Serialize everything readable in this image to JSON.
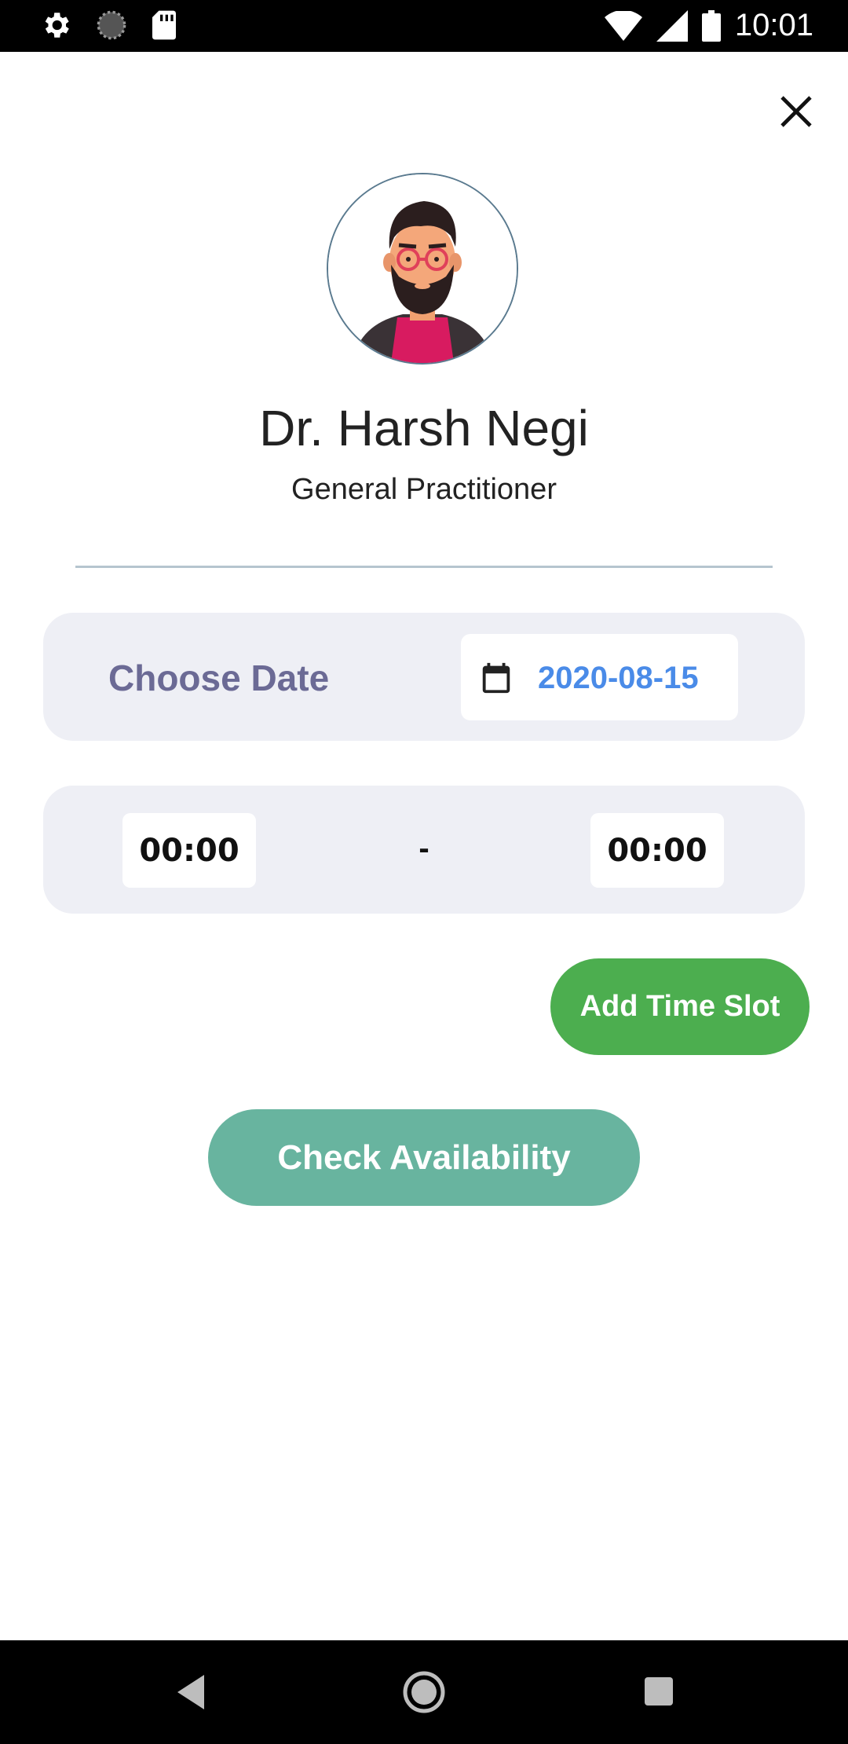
{
  "status_bar": {
    "time": "10:01",
    "left_icons": [
      "settings-icon",
      "loading-icon",
      "sd-card-icon"
    ],
    "right_icons": [
      "wifi-icon",
      "signal-icon",
      "battery-icon"
    ]
  },
  "doctor": {
    "name": "Dr. Harsh Negi",
    "specialty": "General Practitioner"
  },
  "date_section": {
    "label": "Choose Date",
    "value": "2020-08-15"
  },
  "time_section": {
    "start": "00:00",
    "separator": "-",
    "end": "00:00"
  },
  "buttons": {
    "add_time_slot": "Add Time Slot",
    "check_availability": "Check Availability"
  },
  "colors": {
    "primary_green": "#4cae4f",
    "teal": "#68b49f",
    "date_blue": "#4a8be8",
    "label_purple": "#6b6a95",
    "panel_bg": "#eeeff5"
  }
}
